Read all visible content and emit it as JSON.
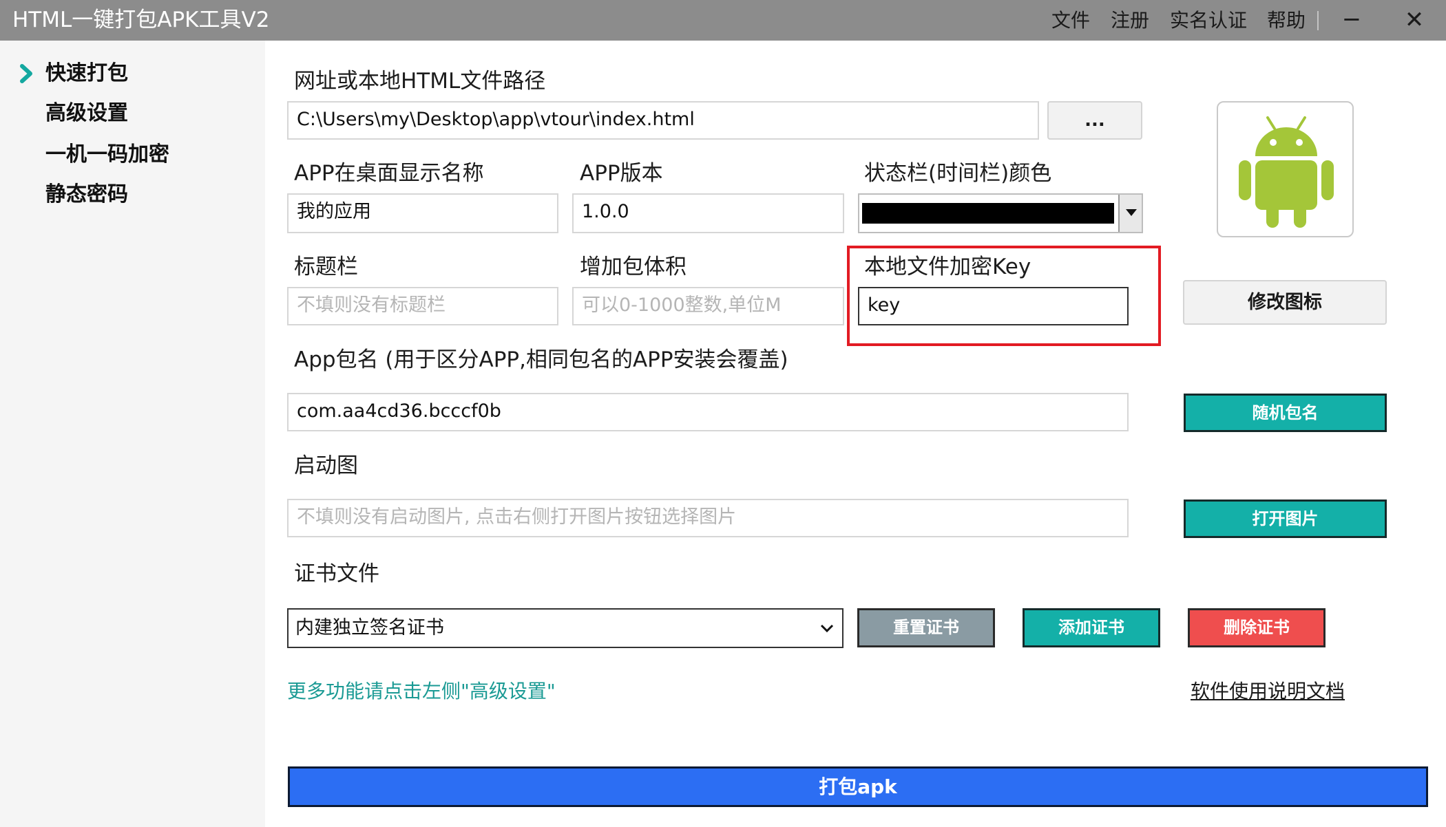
{
  "window": {
    "title": "HTML一键打包APK工具V2",
    "menu": [
      "文件",
      "注册",
      "实名认证",
      "帮助"
    ],
    "minimize_symbol": "─",
    "close_symbol": "✕"
  },
  "sidebar": {
    "items": [
      {
        "label": "快速打包",
        "active": true
      },
      {
        "label": "高级设置",
        "active": false
      },
      {
        "label": "一机一码加密",
        "active": false
      },
      {
        "label": "静态密码",
        "active": false
      }
    ]
  },
  "form": {
    "path": {
      "label": "网址或本地HTML文件路径",
      "value": "C:\\Users\\my\\Desktop\\app\\vtour\\index.html",
      "browse_label": "..."
    },
    "app_name": {
      "label": "APP在桌面显示名称",
      "value": "我的应用"
    },
    "app_version": {
      "label": "APP版本",
      "value": "1.0.0"
    },
    "statusbar_color": {
      "label": "状态栏(时间栏)颜色",
      "value": "#000000"
    },
    "titlebar": {
      "label": "标题栏",
      "placeholder": "不填则没有标题栏"
    },
    "pad_size": {
      "label": "增加包体积",
      "placeholder": "可以0-1000整数,单位M"
    },
    "encrypt_key": {
      "label": "本地文件加密Key",
      "value": "key"
    },
    "package_name": {
      "label": "App包名 (用于区分APP,相同包名的APP安装会覆盖)",
      "value": "com.aa4cd36.bcccf0b",
      "random_label": "随机包名"
    },
    "splash": {
      "label": "启动图",
      "placeholder": "不填则没有启动图片, 点击右侧打开图片按钮选择图片",
      "open_label": "打开图片"
    },
    "cert": {
      "label": "证书文件",
      "selected": "内建独立签名证书",
      "reset_label": "重置证书",
      "add_label": "添加证书",
      "delete_label": "删除证书"
    }
  },
  "icon": {
    "name": "android-robot-icon",
    "change_label": "修改图标",
    "color": "#a4c639"
  },
  "links": {
    "hint": "更多功能请点击左侧\"高级设置\"",
    "doc": "软件使用说明文档"
  },
  "pack_button": "打包apk",
  "colors": {
    "teal": "#14b0a8",
    "blue": "#2c6ef3",
    "red": "#ef4e4e",
    "highlight": "#e21b23"
  }
}
